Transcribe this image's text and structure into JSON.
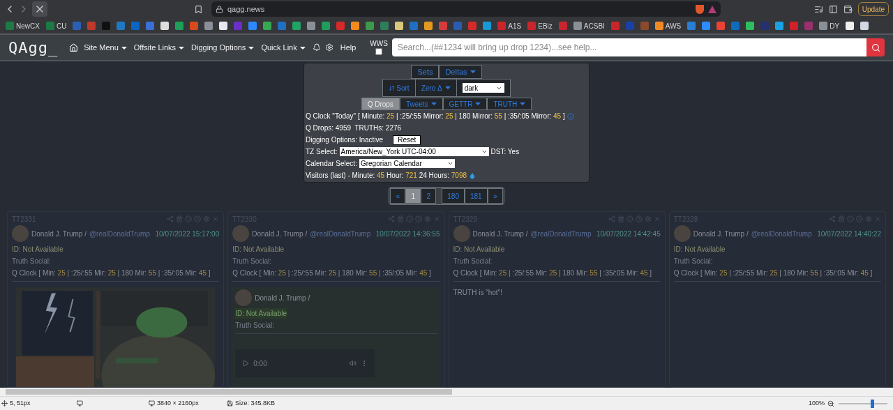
{
  "browser": {
    "address": "qagg.news",
    "update_label": "Update"
  },
  "bookmarks": [
    {
      "label": "NewCX",
      "color": "#1d7a45"
    },
    {
      "label": "CU",
      "color": "#1d7a45"
    },
    {
      "color": "#2b5fb3"
    },
    {
      "color": "#c0392b"
    },
    {
      "color": "#111111"
    },
    {
      "color": "#1f78c1"
    },
    {
      "color": "#0a66c2"
    },
    {
      "color": "#3b6fd8"
    },
    {
      "color": "#dddddd"
    },
    {
      "color": "#1e9e5a"
    },
    {
      "color": "#d64a1b"
    },
    {
      "color": "#8a8f98"
    },
    {
      "color": "#e8e8f0"
    },
    {
      "color": "#6b2fc9"
    },
    {
      "color": "#2d88ff"
    },
    {
      "color": "#34a853"
    },
    {
      "color": "#1f6fc2"
    },
    {
      "color": "#1fa463"
    },
    {
      "color": "#8a8f98"
    },
    {
      "color": "#1e9e5a"
    },
    {
      "color": "#d42a2a"
    },
    {
      "color": "#f28a1e"
    },
    {
      "color": "#3c9a4a"
    },
    {
      "color": "#2e7d5b"
    },
    {
      "color": "#d9c77a"
    },
    {
      "color": "#1f6fc2"
    },
    {
      "color": "#e39a1c"
    },
    {
      "color": "#d43b3b"
    },
    {
      "color": "#2a5db0"
    },
    {
      "color": "#d42a2a"
    },
    {
      "color": "#1798d5"
    },
    {
      "label": "A1S",
      "color": "#c9252c"
    },
    {
      "label": "EBiz",
      "color": "#c9252c"
    },
    {
      "color": "#c9252c"
    },
    {
      "label": "ACSBI",
      "color": "#8a8f98"
    },
    {
      "color": "#c9252c"
    },
    {
      "color": "#1a3fa8"
    },
    {
      "color": "#8a4a2a"
    },
    {
      "label": "AWS",
      "color": "#f08a24"
    },
    {
      "color": "#2a7fd4"
    },
    {
      "color": "#2d8cff"
    },
    {
      "color": "#ea4335"
    },
    {
      "color": "#0f6cbd"
    },
    {
      "color": "#2dbe60"
    },
    {
      "color": "#25316d"
    },
    {
      "color": "#1ba1e2"
    },
    {
      "color": "#d0202a"
    },
    {
      "color": "#9b2f6e"
    },
    {
      "label": "DY",
      "color": "#8a8f98"
    },
    {
      "color": "#f0f0f0"
    },
    {
      "color": "#cfd8e3"
    }
  ],
  "site": {
    "logo": "QAgg_",
    "menu": [
      {
        "label": "Site Menu",
        "dropdown": true
      },
      {
        "label": "Offsite Links",
        "dropdown": true
      },
      {
        "label": "Digging Options",
        "dropdown": true
      },
      {
        "label": "Quick Link",
        "dropdown": true
      }
    ],
    "help": "Help",
    "wws": {
      "label": "WWS",
      "checked": false
    },
    "search": {
      "placeholder": "Search...(##1234 will bring up drop 1234)...see help..."
    }
  },
  "panel": {
    "row1": [
      {
        "label": "Sets",
        "dropdown": false
      },
      {
        "label": "Deltas",
        "dropdown": true
      }
    ],
    "row2": [
      {
        "label": "Sort",
        "dropdown": false
      },
      {
        "label": "Zero Δ",
        "dropdown": true
      }
    ],
    "theme_select": "dark",
    "sources": [
      {
        "label": "Q Drops",
        "dropdown": false,
        "selected": true
      },
      {
        "label": "Tweets",
        "dropdown": true,
        "selected": false
      },
      {
        "label": "GETTR",
        "dropdown": true,
        "selected": false
      },
      {
        "label": "TRUTH",
        "dropdown": true,
        "selected": false
      }
    ],
    "q_clock": [
      {
        "text": "Q Clock \"Today\" [ Minute: ",
        "kind": "label"
      },
      {
        "text": "25",
        "kind": "value"
      },
      {
        "text": " | :25/:55 Mirror: ",
        "kind": "label"
      },
      {
        "text": "25",
        "kind": "value"
      },
      {
        "text": " | 180 Mirror: ",
        "kind": "label"
      },
      {
        "text": "55",
        "kind": "value"
      },
      {
        "text": " | :35/:05 Mirror: ",
        "kind": "label"
      },
      {
        "text": "45",
        "kind": "value"
      },
      {
        "text": " ]",
        "kind": "label"
      }
    ],
    "counts": "Q Drops: 4959  TRUTHs: 2276",
    "digging": "Digging Options: Inactive",
    "reset": "Reset",
    "tz_label": "TZ Select:",
    "tz_value": "America/New_York UTC-04:00",
    "dst": "DST: Yes",
    "calendar_label": "Calendar Select:",
    "calendar_value": "Gregorian Calendar",
    "visitors": [
      {
        "text": "Visitors (last) - Minute: ",
        "kind": "label"
      },
      {
        "text": "45",
        "kind": "value"
      },
      {
        "text": " Hour: ",
        "kind": "label"
      },
      {
        "text": "721",
        "kind": "value"
      },
      {
        "text": " 24 Hours: ",
        "kind": "label"
      },
      {
        "text": "7098",
        "kind": "value"
      }
    ]
  },
  "pagination": [
    {
      "label": "«",
      "selected": false
    },
    {
      "label": "1",
      "selected": true
    },
    {
      "label": "2",
      "selected": false
    },
    {
      "label": "180",
      "selected": false
    },
    {
      "label": "181",
      "selected": false
    },
    {
      "label": "»",
      "selected": false
    }
  ],
  "cards": [
    {
      "id": "TT2331",
      "author": "Donald J. Trump /",
      "handle": "@realDonaldTrump",
      "date": "10/07/2022 15:17:00",
      "clock": [
        {
          "text": "Q Clock [ Min: ",
          "kind": "label"
        },
        {
          "text": "25",
          "kind": "value"
        },
        {
          "text": " | :25/:55 Mir: ",
          "kind": "label"
        },
        {
          "text": "25",
          "kind": "value"
        },
        {
          "text": " | 180 Mir: ",
          "kind": "label"
        },
        {
          "text": "55",
          "kind": "value"
        },
        {
          "text": " | :35/:05 Mir: ",
          "kind": "label"
        },
        {
          "text": "45",
          "kind": "value"
        },
        {
          "text": " ]",
          "kind": "label"
        }
      ],
      "id_line": "ID: Not Available",
      "truth_label": "Truth Social:"
    },
    {
      "id": "TT2330",
      "author": "Donald J. Trump /",
      "handle": "@realDonaldTrump",
      "date": "10/07/2022 14:36:55",
      "clock": [
        {
          "text": "Q Clock [ Min: ",
          "kind": "label"
        },
        {
          "text": "25",
          "kind": "value"
        },
        {
          "text": " | :25/:55 Mir: ",
          "kind": "label"
        },
        {
          "text": "25",
          "kind": "value"
        },
        {
          "text": " | 180 Mir: ",
          "kind": "label"
        },
        {
          "text": "55",
          "kind": "value"
        },
        {
          "text": " | :35/:05 Mir: ",
          "kind": "label"
        },
        {
          "text": "45",
          "kind": "value"
        },
        {
          "text": " ]",
          "kind": "label"
        }
      ],
      "id_line": "ID: Not Available",
      "truth_label": "Truth Social:",
      "body": {
        "kind": "quote",
        "author": "Donald J. Trump /",
        "id_line": "ID: Not Available",
        "truth_label": "Truth Social:",
        "audio_time": "0:00"
      }
    },
    {
      "id": "TT2329",
      "author": "Donald J. Trump /",
      "handle": "@realDonaldTrump",
      "date": "10/07/2022 14:42:45",
      "clock": [
        {
          "text": "Q Clock [ Min: ",
          "kind": "label"
        },
        {
          "text": "25",
          "kind": "value"
        },
        {
          "text": " | :25/:55 Mir: ",
          "kind": "label"
        },
        {
          "text": "25",
          "kind": "value"
        },
        {
          "text": " | 180 Mir: ",
          "kind": "label"
        },
        {
          "text": "55",
          "kind": "value"
        },
        {
          "text": " | :35/:05 Mir: ",
          "kind": "label"
        },
        {
          "text": "45",
          "kind": "value"
        },
        {
          "text": " ]",
          "kind": "label"
        }
      ],
      "id_line": "ID: Not Available",
      "truth_label": "Truth Social:",
      "body": {
        "kind": "text",
        "text": "TRUTH is \"hot\"!"
      }
    },
    {
      "id": "TT2328",
      "author": "Donald J. Trump /",
      "handle": "@realDonaldTrump",
      "date": "10/07/2022 14:40:22",
      "clock": [
        {
          "text": "Q Clock [ Min: ",
          "kind": "label"
        },
        {
          "text": "25",
          "kind": "value"
        },
        {
          "text": " | :25/:55 Mir: ",
          "kind": "label"
        },
        {
          "text": "25",
          "kind": "value"
        },
        {
          "text": " | 180 Mir: ",
          "kind": "label"
        },
        {
          "text": "55",
          "kind": "value"
        },
        {
          "text": " | :35/:05 Mir: ",
          "kind": "label"
        },
        {
          "text": "45",
          "kind": "value"
        },
        {
          "text": " ]",
          "kind": "label"
        }
      ],
      "id_line": "ID: Not Available",
      "truth_label": "Truth Social:",
      "body": {
        "kind": "empty"
      }
    }
  ],
  "status_bar": {
    "cursor": "5, 51px",
    "dimensions": "3840 × 2160px",
    "size": "Size: 345.8KB",
    "zoom": "100%",
    "zoom_level": {
      "level": 0.7
    }
  }
}
